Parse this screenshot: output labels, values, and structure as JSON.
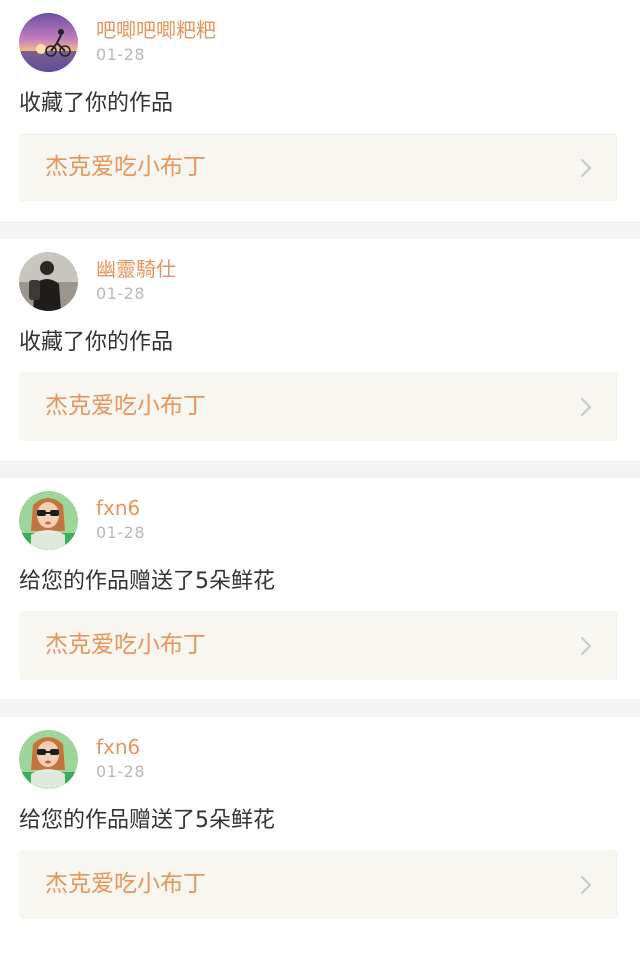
{
  "notifications": [
    {
      "username": "吧唧吧唧粑粑",
      "date": "01-28",
      "action": "收藏了你的作品",
      "work_title": "杰克爱吃小布丁",
      "avatar": "sunset-cyclist-avatar"
    },
    {
      "username": "幽靈騎仕",
      "date": "01-28",
      "action": "收藏了你的作品",
      "work_title": "杰克爱吃小布丁",
      "avatar": "person-with-backpack-avatar"
    },
    {
      "username": "fxn6",
      "date": "01-28",
      "action": "给您的作品赠送了5朵鲜花",
      "work_title": "杰克爱吃小布丁",
      "avatar": "girl-with-sunglasses-avatar"
    },
    {
      "username": "fxn6",
      "date": "01-28",
      "action": "给您的作品赠送了5朵鲜花",
      "work_title": "杰克爱吃小布丁",
      "avatar": "girl-with-sunglasses-avatar"
    }
  ],
  "colors": {
    "accent": "#e8955d",
    "date": "#b9b9b9",
    "card_background": "#f7f6f1",
    "separator": "#f4f4f4"
  }
}
